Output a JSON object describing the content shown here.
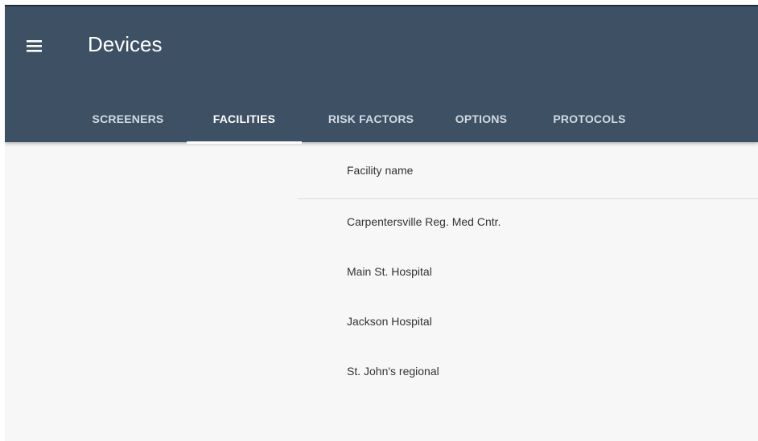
{
  "header": {
    "title": "Devices",
    "menu_icon": "hamburger-menu-icon"
  },
  "tabs": [
    {
      "label": "SCREENERS",
      "active": false
    },
    {
      "label": "FACILITIES",
      "active": true
    },
    {
      "label": "RISK FACTORS",
      "active": false
    },
    {
      "label": "OPTIONS",
      "active": false
    },
    {
      "label": "PROTOCOLS",
      "active": false
    }
  ],
  "facilities": {
    "column_header": "Facility name",
    "rows": [
      "Carpentersville Reg. Med Cntr.",
      "Main St. Hospital",
      "Jackson Hospital",
      "St. John's regional"
    ]
  },
  "colors": {
    "appbar": "#3e5064",
    "tab_indicator": "#ffffff",
    "background": "#f7f7f7"
  }
}
